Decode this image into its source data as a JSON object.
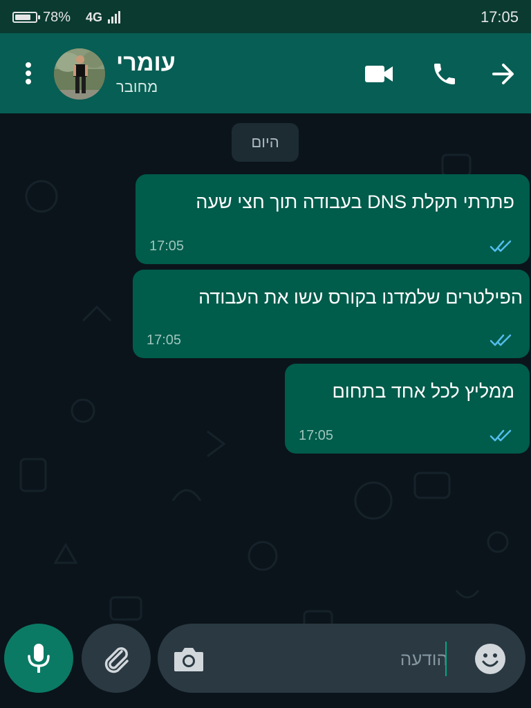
{
  "status_bar": {
    "battery_text": "78%",
    "battery_level": 0.78,
    "network": "4G",
    "time": "17:05"
  },
  "header": {
    "contact_name": "עומרי",
    "contact_status": "מחובר",
    "icons": [
      "more-vert-icon",
      "video-call-icon",
      "phone-icon",
      "arrow-forward-icon"
    ]
  },
  "chat": {
    "date_label": "היום",
    "messages": [
      {
        "text": "פתרתי תקלת DNS בעבודה תוך חצי שעה",
        "time": "17:05",
        "status": "read"
      },
      {
        "text": "הפילטרים שלמדנו בקורס עשו את העבודה",
        "time": "17:05",
        "status": "read"
      },
      {
        "text": "ממליץ לכל אחד בתחום",
        "time": "17:05",
        "status": "read"
      }
    ]
  },
  "composer": {
    "placeholder": "הודעה",
    "value": "",
    "icons": [
      "mic-icon",
      "attach-icon",
      "camera-icon",
      "emoji-icon"
    ]
  },
  "colors": {
    "header": "#075e54",
    "status_bar": "#0a3a30",
    "chat_background": "#0b141a",
    "outgoing_bubble": "#005c4b",
    "read_tick": "#53bdeb",
    "composer": "#2a3942",
    "mic_button": "#0b7a65"
  }
}
